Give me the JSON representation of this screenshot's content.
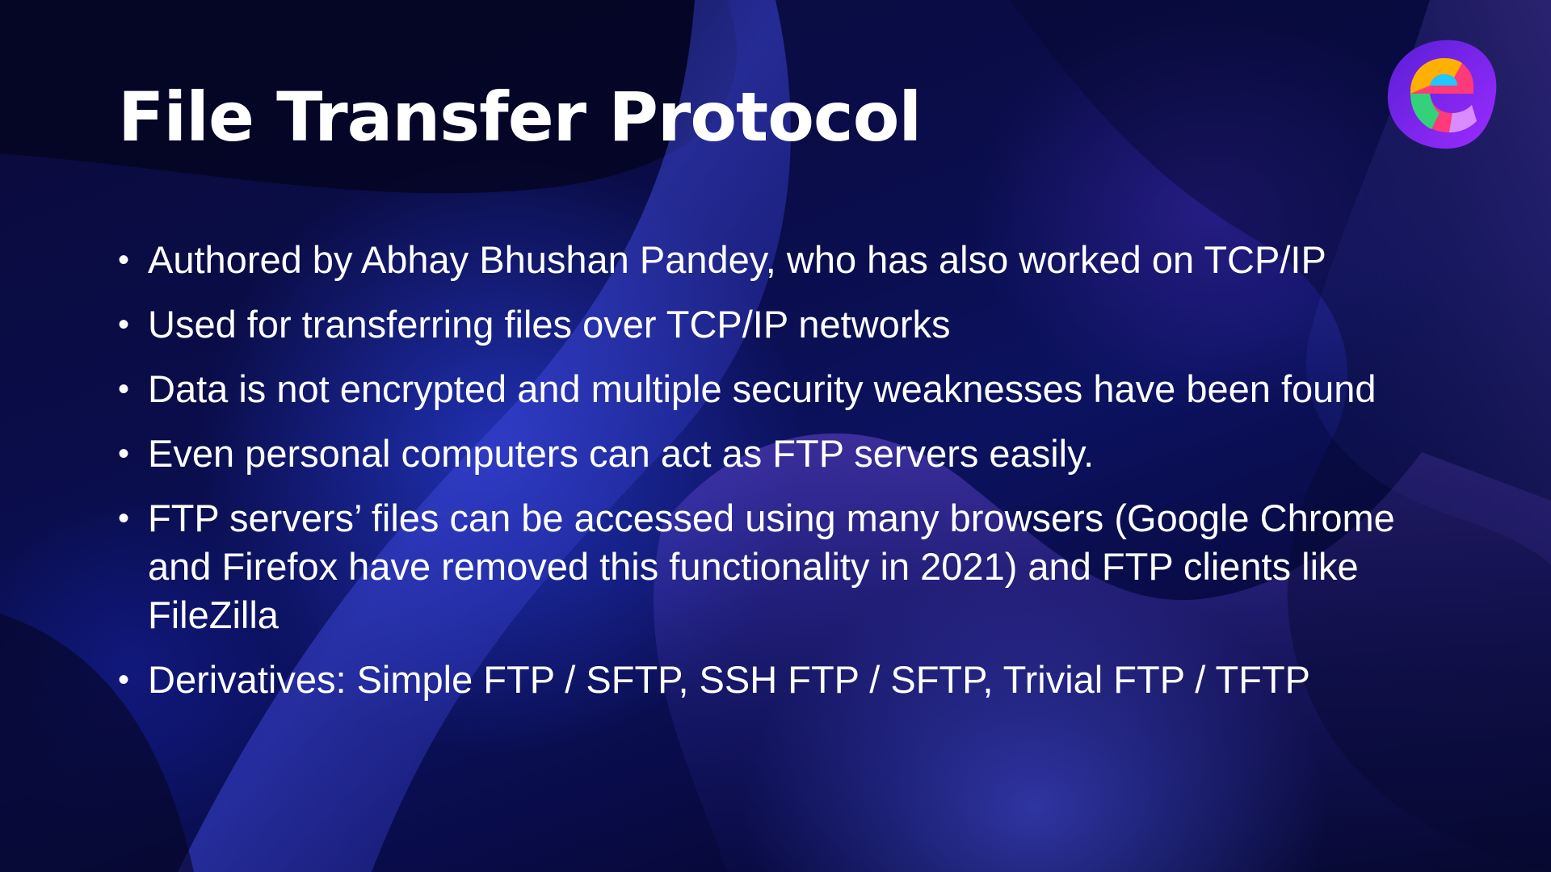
{
  "slide": {
    "title": "File Transfer Protocol",
    "bullet_symbol": "•",
    "bullets": [
      "Authored by Abhay Bhushan Pandey, who has also worked on TCP/IP",
      "Used for transferring files over TCP/IP networks",
      "Data is not encrypted and multiple security weaknesses have been found",
      "Even personal computers can act as FTP servers easily.",
      "FTP servers’ files can be accessed using many browsers (Google Chrome and Firefox have removed this functionality in 2021) and FTP clients like FileZilla",
      "Derivatives: Simple FTP / SFTP, SSH FTP / SFTP, Trivial FTP / TFTP"
    ]
  },
  "logo": {
    "icon": "e-letter-logo-icon",
    "colors": [
      "#7b2cff",
      "#ff3a7a",
      "#ffb000",
      "#1fc6ff",
      "#33d17a"
    ]
  },
  "theme": {
    "background": "#06072a",
    "text": "#ffffff"
  }
}
